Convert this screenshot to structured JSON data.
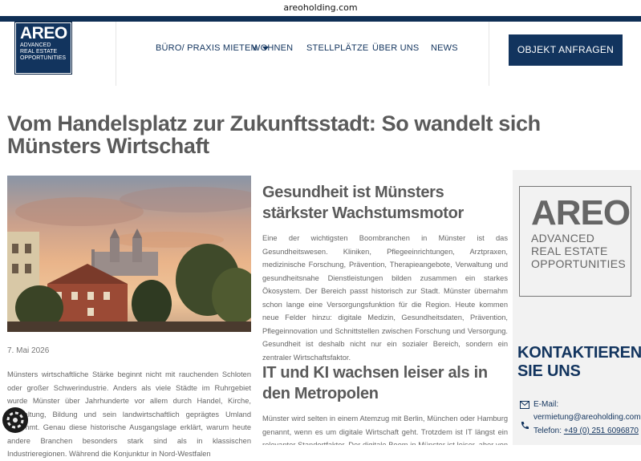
{
  "browser": {
    "url": "areoholding.com"
  },
  "logo": {
    "name": "AREO",
    "line1": "ADVANCED",
    "line2": "REAL ESTATE",
    "line3": "OPPORTUNITIES"
  },
  "nav": {
    "items": [
      {
        "label": "BÜRO/ PRAXIS MIETEN"
      },
      {
        "label": "WOHNEN"
      },
      {
        "label": "STELLPLÄTZE"
      },
      {
        "label": "ÜBER UNS"
      },
      {
        "label": "NEWS"
      }
    ],
    "cta": "OBJEKT ANFRAGEN"
  },
  "article": {
    "title": "Vom Handelsplatz zur Zukunftsstadt: So wandelt sich Münsters Wirtschaft",
    "date": "7. Mai 2026",
    "intro": "Münsters wirtschaftliche Stärke beginnt nicht mit rauchenden Schloten oder großer Schwerindustrie. Anders als viele Städte im Ruhrgebiet wurde Münster über Jahrhunderte vor allem durch Handel, Kirche, Verwaltung, Bildung und sein landwirtschaftlich geprägtes Umland bestimmt. Genau diese historische Ausgangslage erklärt, warum heute andere Branchen besonders stark sind als in klassischen Industrieregionen. Während die Konjunktur in Nord-Westfalen",
    "section1": {
      "heading": "Gesundheit ist Münsters stärkster Wachstumsmotor",
      "body": "Eine der wichtigsten Boombranchen in Münster ist das Gesundheitswesen. Kliniken, Pflegeeinrichtungen, Arztpraxen, medizinische Forschung, Prävention, Therapieangebote, Verwaltung und gesundheitsnahe Dienstleistungen bilden zusammen ein starkes Ökosystem. Der Bereich passt historisch zur Stadt. Münster übernahm schon lange eine Versorgungsfunktion für die Region. Heute kommen neue Felder hinzu: digitale Medizin, Gesundheitsdaten, Prävention, Pflegeinnovation und Schnittstellen zwischen Forschung und Versorgung. Gesundheit ist deshalb nicht nur ein sozialer Bereich, sondern ein zentraler Wirtschaftsfaktor."
    },
    "section2": {
      "heading": "IT und KI wachsen leiser als in den Metropolen",
      "body": "Münster wird selten in einem Atemzug mit Berlin, München oder Hamburg genannt, wenn es um digitale Wirtschaft geht. Trotzdem ist IT längst ein relevanter Standortfaktor. Der digitale Boom in Münster ist leiser, aber von mit"
    }
  },
  "sidebar": {
    "logo": {
      "name": "AREO",
      "line1": "ADVANCED",
      "line2": "REAL ESTATE",
      "line3": "OPPORTUNITIES"
    },
    "contact_heading": "KONTAKTIEREN SIE UNS",
    "email_label": "E-Mail:",
    "email": "vermietung@areoholding.com",
    "phone_label": "Telefon:",
    "phone": "+49 (0) 251 6096870"
  },
  "colors": {
    "brand": "#12345e",
    "text": "#5a5a5a",
    "sidebar": "#f2f2f2"
  }
}
